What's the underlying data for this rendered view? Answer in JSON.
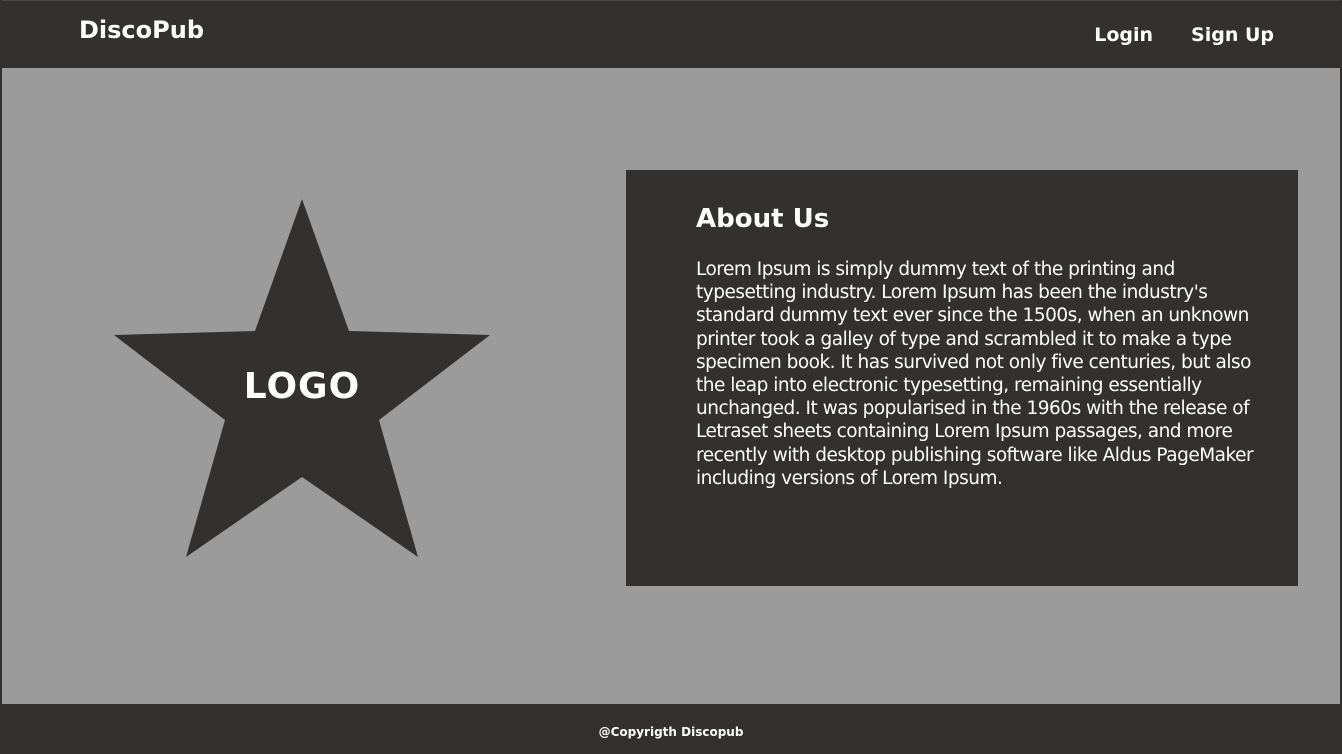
{
  "header": {
    "brand": "DiscoPub",
    "nav": {
      "login_label": "Login",
      "signup_label": "Sign Up"
    }
  },
  "logo": {
    "text": "LOGO",
    "shape_icon": "star-icon"
  },
  "about": {
    "title": "About Us",
    "body": "Lorem Ipsum is simply dummy text of the printing and typesetting industry. Lorem Ipsum has been the industry's standard dummy text ever since the 1500s, when an unknown printer took a galley of type and scrambled it to make a type specimen book. It has survived not only five centuries, but also the leap into electronic typesetting, remaining essentially unchanged. It was popularised in the 1960s with the release of Letraset sheets containing Lorem Ipsum passages, and more recently with desktop publishing software like Aldus PageMaker including versions of Lorem Ipsum."
  },
  "footer": {
    "copyright": "@Copyrigth Discopub"
  },
  "colors": {
    "dark": "#323130",
    "background": "#9b9b9b",
    "text": "#ffffff"
  }
}
